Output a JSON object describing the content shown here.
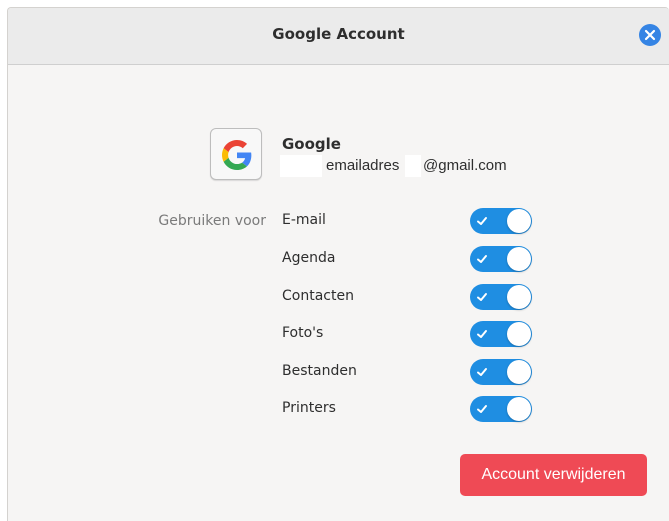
{
  "window": {
    "title": "Google Account"
  },
  "account": {
    "provider": "Google",
    "email_user": "emailadres",
    "email_domain": "@gmail.com"
  },
  "services": {
    "use_for_label": "Gebruiken voor",
    "items": [
      {
        "label": "E-mail",
        "enabled": true
      },
      {
        "label": "Agenda",
        "enabled": true
      },
      {
        "label": "Contacten",
        "enabled": true
      },
      {
        "label": "Foto's",
        "enabled": true
      },
      {
        "label": "Bestanden",
        "enabled": true
      },
      {
        "label": "Printers",
        "enabled": true
      }
    ]
  },
  "actions": {
    "remove_label": "Account verwijderen"
  },
  "icons": {
    "close": "close-icon",
    "logo": "google-logo-icon",
    "check": "check-icon"
  },
  "colors": {
    "accent": "#3584e4",
    "toggle_on": "#1f8ee2",
    "destructive": "#ef4a55"
  }
}
